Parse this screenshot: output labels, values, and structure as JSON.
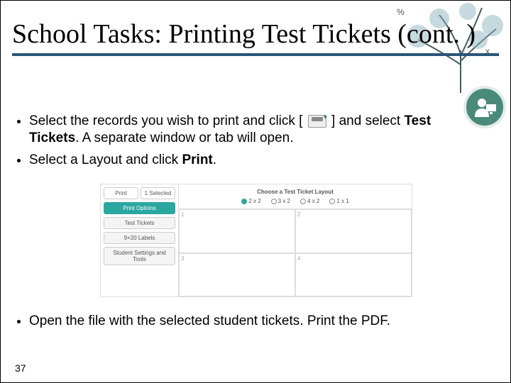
{
  "title": "School Tasks: Printing Test Tickets (cont. )",
  "bullets": {
    "b1a": "Select the records you wish to print and click [",
    "b1b": "] and select ",
    "b1_bold": "Test Tickets",
    "b1c": ". A separate window or tab will open.",
    "b2a": "Select a Layout and click ",
    "b2_bold": "Print",
    "b2b": ".",
    "b3": "Open the file with the selected student tickets. Print the PDF."
  },
  "mock": {
    "left": {
      "pill1a": "Print",
      "pill1b": "1 Selected",
      "pill2": "Print Options",
      "pill3": "Test Tickets",
      "pill4": "9×20 Labels",
      "pill5": "Student Settings and Tools"
    },
    "header": "Choose a Test Ticket Layout",
    "opts": {
      "o1": "2 x 2",
      "o2": "3 x 2",
      "o3": "4 x 2",
      "o4": "1 x 1"
    },
    "cells": {
      "c1": "1",
      "c2": "2",
      "c3": "3",
      "c4": "4"
    }
  },
  "page": "37"
}
